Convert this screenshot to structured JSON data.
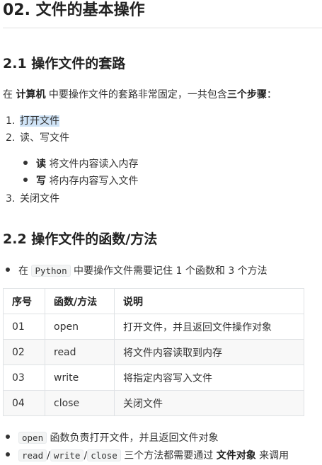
{
  "title": "02. 文件的基本操作",
  "section1": {
    "heading": "2.1 操作文件的套路",
    "intro_pre": "在 ",
    "intro_b1": "计算机",
    "intro_mid": " 中要操作文件的套路非常固定，一共包含",
    "intro_b2": "三个步骤",
    "intro_end": "：",
    "steps": [
      {
        "num": "1.",
        "text": "打开文件"
      },
      {
        "num": "2.",
        "text": "读、写文件"
      },
      {
        "num": "3.",
        "text": "关闭文件"
      }
    ],
    "sub": [
      {
        "bold": "读",
        "text": " 将文件内容读入内存"
      },
      {
        "bold": "写",
        "text": " 将内存内容写入文件"
      }
    ]
  },
  "section2": {
    "heading": "2.2 操作文件的函数/方法",
    "bullet_pre": "在 ",
    "bullet_code": "Python",
    "bullet_post": " 中要操作文件需要记住 1 个函数和 3 个方法",
    "table": {
      "headers": [
        "序号",
        "函数/方法",
        "说明"
      ],
      "rows": [
        [
          "01",
          "open",
          "打开文件，并且返回文件操作对象"
        ],
        [
          "02",
          "read",
          "将文件内容读取到内存"
        ],
        [
          "03",
          "write",
          "将指定内容写入文件"
        ],
        [
          "04",
          "close",
          "关闭文件"
        ]
      ]
    },
    "note1_code": "open",
    "note1_text": " 函数负责打开文件，并且返回文件对象",
    "note2_code1": "read",
    "note2_sep1": "/",
    "note2_code2": "write",
    "note2_sep2": "/",
    "note2_code3": "close",
    "note2_mid": " 三个方法都需要通过 ",
    "note2_bold": "文件对象",
    "note2_end": " 来调用"
  }
}
